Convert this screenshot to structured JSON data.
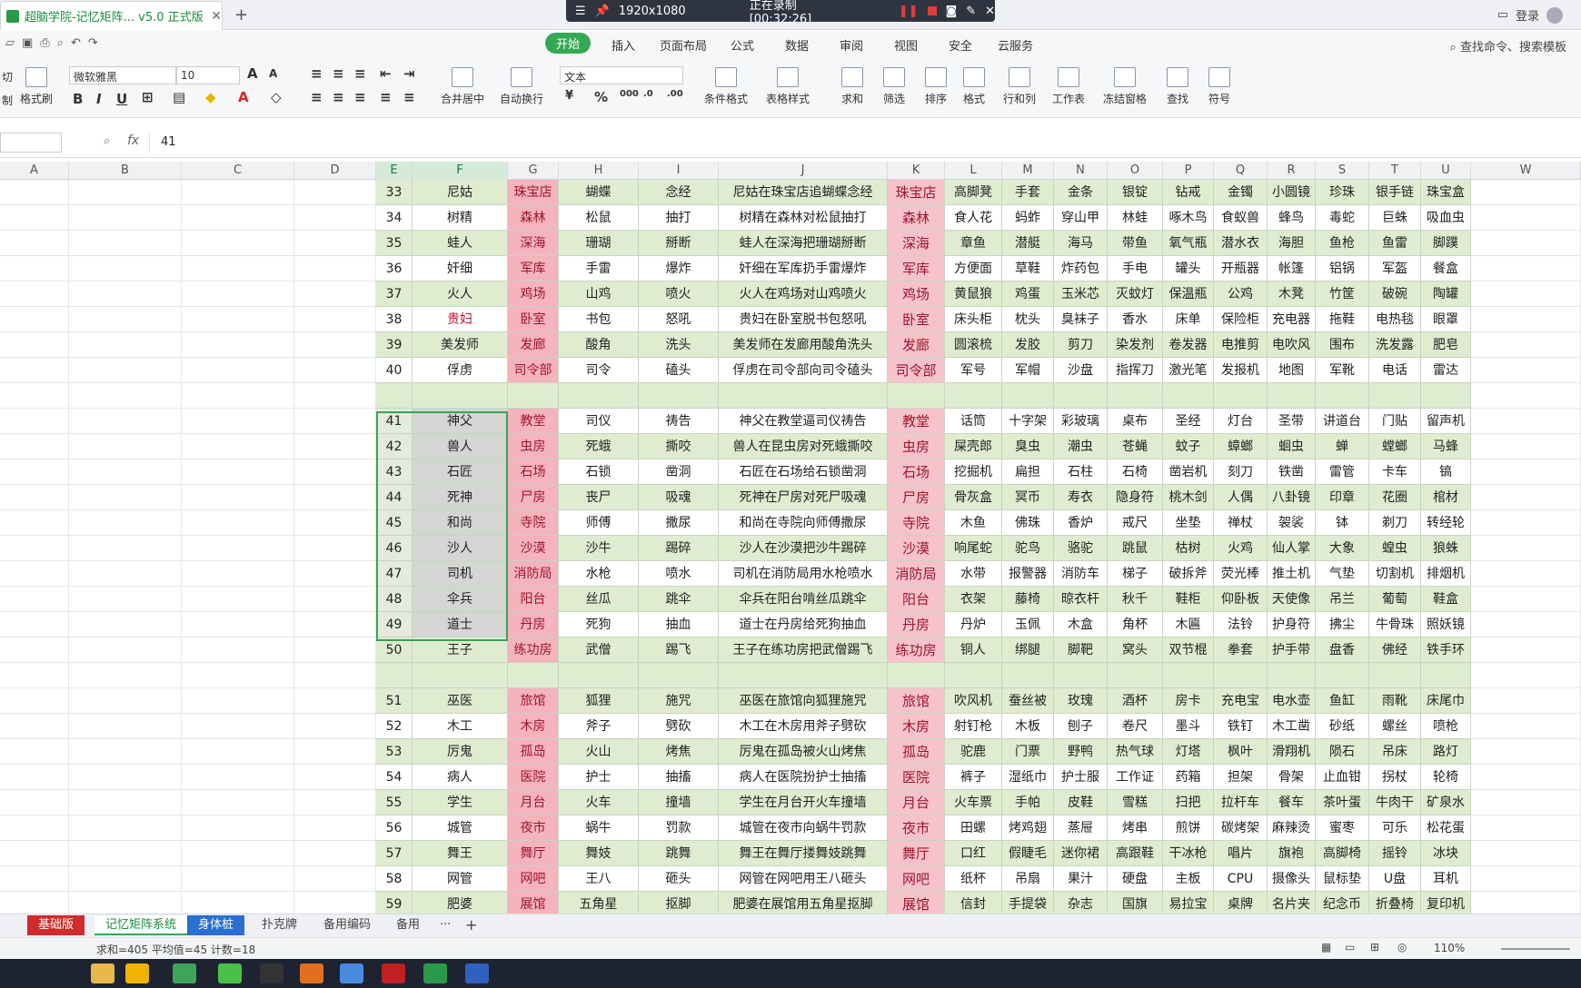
{
  "titlebar": {
    "doc_tab": "超脑学院-记忆矩阵... v5.0 正式版",
    "login": "登录"
  },
  "recorder": {
    "resolution": "1920x1080",
    "status": "正在录制 [00:32:26]"
  },
  "menu": {
    "items": [
      "开始",
      "插入",
      "页面布局",
      "公式",
      "数据",
      "审阅",
      "视图",
      "安全",
      "云服务"
    ],
    "search": "查找命令、搜索模板"
  },
  "ribbon": {
    "font_name": "微软雅黑",
    "font_size": "10",
    "number_format": "文本",
    "left_labels": [
      "切",
      "制",
      "格式刷"
    ],
    "buttons": [
      "合并居中",
      "自动换行",
      "条件格式",
      "表格样式",
      "求和",
      "筛选",
      "排序",
      "格式",
      "行和列",
      "工作表",
      "冻结窗格",
      "查找",
      "符号"
    ]
  },
  "formula": {
    "cell_value": "41",
    "fx": "fx"
  },
  "columns": [
    "A",
    "B",
    "C",
    "D",
    "E",
    "F",
    "G",
    "H",
    "I",
    "J",
    "K",
    "L",
    "M",
    "N",
    "O",
    "P",
    "Q",
    "R",
    "S",
    "T",
    "U",
    "W"
  ],
  "rows": [
    {
      "n": "33",
      "f": "尼姑",
      "g": "珠宝店",
      "h": "蝴蝶",
      "i": "念经",
      "j": "尼姑在珠宝店追蝴蝶念经",
      "k": "珠宝店",
      "rest": [
        "高脚凳",
        "手套",
        "金条",
        "银锭",
        "钻戒",
        "金镯",
        "小圆镜",
        "珍珠",
        "银手链",
        "珠宝盒"
      ]
    },
    {
      "n": "34",
      "f": "树精",
      "g": "森林",
      "h": "松鼠",
      "i": "抽打",
      "j": "树精在森林对松鼠抽打",
      "k": "森林",
      "rest": [
        "食人花",
        "蚂蚱",
        "穿山甲",
        "林蛙",
        "啄木鸟",
        "食蚁兽",
        "蜂鸟",
        "毒蛇",
        "巨蛛",
        "吸血虫"
      ]
    },
    {
      "n": "35",
      "f": "蛙人",
      "g": "深海",
      "h": "珊瑚",
      "i": "掰断",
      "j": "蛙人在深海把珊瑚掰断",
      "k": "深海",
      "rest": [
        "章鱼",
        "潜艇",
        "海马",
        "带鱼",
        "氧气瓶",
        "潜水衣",
        "海胆",
        "鱼枪",
        "鱼雷",
        "脚蹼"
      ]
    },
    {
      "n": "36",
      "f": "奸细",
      "g": "军库",
      "h": "手雷",
      "i": "爆炸",
      "j": "奸细在军库扔手雷爆炸",
      "k": "军库",
      "rest": [
        "方便面",
        "草鞋",
        "炸药包",
        "手电",
        "罐头",
        "开瓶器",
        "帐篷",
        "铝锅",
        "军盔",
        "餐盒"
      ]
    },
    {
      "n": "37",
      "f": "火人",
      "g": "鸡场",
      "h": "山鸡",
      "i": "喷火",
      "j": "火人在鸡场对山鸡喷火",
      "k": "鸡场",
      "rest": [
        "黄鼠狼",
        "鸡蛋",
        "玉米芯",
        "灭蚊灯",
        "保温瓶",
        "公鸡",
        "木凳",
        "竹筐",
        "破碗",
        "陶罐"
      ]
    },
    {
      "n": "38",
      "f": "贵妇",
      "g": "卧室",
      "h": "书包",
      "i": "怒吼",
      "j": "贵妇在卧室脱书包怒吼",
      "k": "卧室",
      "rest": [
        "床头柜",
        "枕头",
        "臭袜子",
        "香水",
        "床单",
        "保险柜",
        "充电器",
        "拖鞋",
        "电热毯",
        "眼罩"
      ],
      "fred": true
    },
    {
      "n": "39",
      "f": "美发师",
      "g": "发廊",
      "h": "酸角",
      "i": "洗头",
      "j": "美发师在发廊用酸角洗头",
      "k": "发廊",
      "rest": [
        "圆滚梳",
        "发胶",
        "剪刀",
        "染发剂",
        "卷发器",
        "电推剪",
        "电吹风",
        "围布",
        "洗发露",
        "肥皂"
      ]
    },
    {
      "n": "40",
      "f": "俘虏",
      "g": "司令部",
      "h": "司令",
      "i": "磕头",
      "j": "俘虏在司令部向司令磕头",
      "k": "司令部",
      "rest": [
        "军号",
        "军帽",
        "沙盘",
        "指挥刀",
        "激光笔",
        "发报机",
        "地图",
        "军靴",
        "电话",
        "雷达"
      ]
    },
    {
      "blank": true
    },
    {
      "n": "41",
      "f": "神父",
      "g": "教堂",
      "h": "司仪",
      "i": "祷告",
      "j": "神父在教堂逼司仪祷告",
      "k": "教堂",
      "rest": [
        "话筒",
        "十字架",
        "彩玻璃",
        "桌布",
        "圣经",
        "灯台",
        "圣带",
        "讲道台",
        "门贴",
        "留声机"
      ],
      "sel": true
    },
    {
      "n": "42",
      "f": "兽人",
      "g": "虫房",
      "h": "死蛾",
      "i": "撕咬",
      "j": "兽人在昆虫房对死蛾撕咬",
      "k": "虫房",
      "rest": [
        "屎壳郎",
        "臭虫",
        "潮虫",
        "苍蝇",
        "蚊子",
        "蟑螂",
        "蛔虫",
        "蝉",
        "螳螂",
        "马蜂"
      ],
      "sel": true
    },
    {
      "n": "43",
      "f": "石匠",
      "g": "石场",
      "h": "石锁",
      "i": "凿洞",
      "j": "石匠在石场给石锁凿洞",
      "k": "石场",
      "rest": [
        "挖掘机",
        "扁担",
        "石柱",
        "石椅",
        "凿岩机",
        "刻刀",
        "铁凿",
        "雷管",
        "卡车",
        "镐"
      ],
      "sel": true
    },
    {
      "n": "44",
      "f": "死神",
      "g": "尸房",
      "h": "丧尸",
      "i": "吸魂",
      "j": "死神在尸房对死尸吸魂",
      "k": "尸房",
      "rest": [
        "骨灰盒",
        "冥币",
        "寿衣",
        "隐身符",
        "桃木剑",
        "人偶",
        "八卦镜",
        "印章",
        "花圈",
        "棺材"
      ],
      "sel": true
    },
    {
      "n": "45",
      "f": "和尚",
      "g": "寺院",
      "h": "师傅",
      "i": "撒尿",
      "j": "和尚在寺院向师傅撒尿",
      "k": "寺院",
      "rest": [
        "木鱼",
        "佛珠",
        "香炉",
        "戒尺",
        "坐垫",
        "禅杖",
        "袈裟",
        "钵",
        "剃刀",
        "转经轮"
      ],
      "sel": true
    },
    {
      "n": "46",
      "f": "沙人",
      "g": "沙漠",
      "h": "沙牛",
      "i": "踢碎",
      "j": "沙人在沙漠把沙牛踢碎",
      "k": "沙漠",
      "rest": [
        "响尾蛇",
        "驼鸟",
        "骆驼",
        "跳鼠",
        "枯树",
        "火鸡",
        "仙人掌",
        "大象",
        "蝗虫",
        "狼蛛"
      ],
      "sel": true
    },
    {
      "n": "47",
      "f": "司机",
      "g": "消防局",
      "h": "水枪",
      "i": "喷水",
      "j": "司机在消防局用水枪喷水",
      "k": "消防局",
      "rest": [
        "水带",
        "报警器",
        "消防车",
        "梯子",
        "破拆斧",
        "荧光棒",
        "推土机",
        "气垫",
        "切割机",
        "排烟机"
      ],
      "sel": true
    },
    {
      "n": "48",
      "f": "伞兵",
      "g": "阳台",
      "h": "丝瓜",
      "i": "跳伞",
      "j": "伞兵在阳台啃丝瓜跳伞",
      "k": "阳台",
      "rest": [
        "衣架",
        "藤椅",
        "晾衣杆",
        "秋千",
        "鞋柜",
        "仰卧板",
        "天使像",
        "吊兰",
        "葡萄",
        "鞋盒"
      ],
      "sel": true
    },
    {
      "n": "49",
      "f": "道士",
      "g": "丹房",
      "h": "死狗",
      "i": "抽血",
      "j": "道士在丹房给死狗抽血",
      "k": "丹房",
      "rest": [
        "丹炉",
        "玉佩",
        "木盒",
        "角杯",
        "木匾",
        "法铃",
        "护身符",
        "拂尘",
        "牛骨珠",
        "照妖镜"
      ],
      "sel": true
    },
    {
      "n": "50",
      "f": "王子",
      "g": "练功房",
      "h": "武僧",
      "i": "踢飞",
      "j": "王子在练功房把武僧踢飞",
      "k": "练功房",
      "rest": [
        "铜人",
        "绑腿",
        "脚靶",
        "窝头",
        "双节棍",
        "拳套",
        "护手带",
        "盘香",
        "佛经",
        "铁手环"
      ]
    },
    {
      "blank": true
    },
    {
      "n": "51",
      "f": "巫医",
      "g": "旅馆",
      "h": "狐狸",
      "i": "施咒",
      "j": "巫医在旅馆向狐狸施咒",
      "k": "旅馆",
      "rest": [
        "吹风机",
        "蚕丝被",
        "玫瑰",
        "酒杯",
        "房卡",
        "充电宝",
        "电水壶",
        "鱼缸",
        "雨靴",
        "床尾巾"
      ]
    },
    {
      "n": "52",
      "f": "木工",
      "g": "木房",
      "h": "斧子",
      "i": "劈砍",
      "j": "木工在木房用斧子劈砍",
      "k": "木房",
      "rest": [
        "射钉枪",
        "木板",
        "刨子",
        "卷尺",
        "墨斗",
        "铁钉",
        "木工凿",
        "砂纸",
        "螺丝",
        "喷枪"
      ]
    },
    {
      "n": "53",
      "f": "厉鬼",
      "g": "孤岛",
      "h": "火山",
      "i": "烤焦",
      "j": "厉鬼在孤岛被火山烤焦",
      "k": "孤岛",
      "rest": [
        "驼鹿",
        "门票",
        "野鸭",
        "热气球",
        "灯塔",
        "枫叶",
        "滑翔机",
        "陨石",
        "吊床",
        "路灯"
      ]
    },
    {
      "n": "54",
      "f": "病人",
      "g": "医院",
      "h": "护士",
      "i": "抽搐",
      "j": "病人在医院扮护士抽搐",
      "k": "医院",
      "rest": [
        "裤子",
        "湿纸巾",
        "护士服",
        "工作证",
        "药箱",
        "担架",
        "骨架",
        "止血钳",
        "拐杖",
        "轮椅"
      ]
    },
    {
      "n": "55",
      "f": "学生",
      "g": "月台",
      "h": "火车",
      "i": "撞墙",
      "j": "学生在月台开火车撞墙",
      "k": "月台",
      "rest": [
        "火车票",
        "手帕",
        "皮鞋",
        "雪糕",
        "扫把",
        "拉杆车",
        "餐车",
        "茶叶蛋",
        "牛肉干",
        "矿泉水"
      ]
    },
    {
      "n": "56",
      "f": "城管",
      "g": "夜市",
      "h": "蜗牛",
      "i": "罚款",
      "j": "城管在夜市向蜗牛罚款",
      "k": "夜市",
      "rest": [
        "田螺",
        "烤鸡翅",
        "蒸屉",
        "烤串",
        "煎饼",
        "碳烤架",
        "麻辣烫",
        "蜜枣",
        "可乐",
        "松花蛋"
      ]
    },
    {
      "n": "57",
      "f": "舞王",
      "g": "舞厅",
      "h": "舞妓",
      "i": "跳舞",
      "j": "舞王在舞厅搂舞妓跳舞",
      "k": "舞厅",
      "rest": [
        "口红",
        "假睫毛",
        "迷你裙",
        "高跟鞋",
        "干冰枪",
        "唱片",
        "旗袍",
        "高脚椅",
        "摇铃",
        "冰块"
      ]
    },
    {
      "n": "58",
      "f": "网管",
      "g": "网吧",
      "h": "王八",
      "i": "砸头",
      "j": "网管在网吧用王八砸头",
      "k": "网吧",
      "rest": [
        "纸杯",
        "吊扇",
        "果汁",
        "硬盘",
        "主板",
        "CPU",
        "摄像头",
        "鼠标垫",
        "U盘",
        "耳机"
      ]
    },
    {
      "n": "59",
      "f": "肥婆",
      "g": "展馆",
      "h": "五角星",
      "i": "抠脚",
      "j": "肥婆在展馆用五角星抠脚",
      "k": "展馆",
      "rest": [
        "信封",
        "手提袋",
        "杂志",
        "国旗",
        "易拉宝",
        "桌牌",
        "名片夹",
        "纪念币",
        "折叠椅",
        "复印机"
      ]
    }
  ],
  "sheets": {
    "tabs": [
      "基础版",
      "记忆矩阵系统",
      "身体桩",
      "扑克牌",
      "备用编码",
      "备用"
    ],
    "more": "···",
    "add": "+"
  },
  "status": {
    "summary": "求和=405  平均值=45  计数=18",
    "zoom": "110%"
  },
  "colors": {
    "green_row": "#dfecd0",
    "tag_pink": "#f4b3bd",
    "accent": "#35a853"
  }
}
